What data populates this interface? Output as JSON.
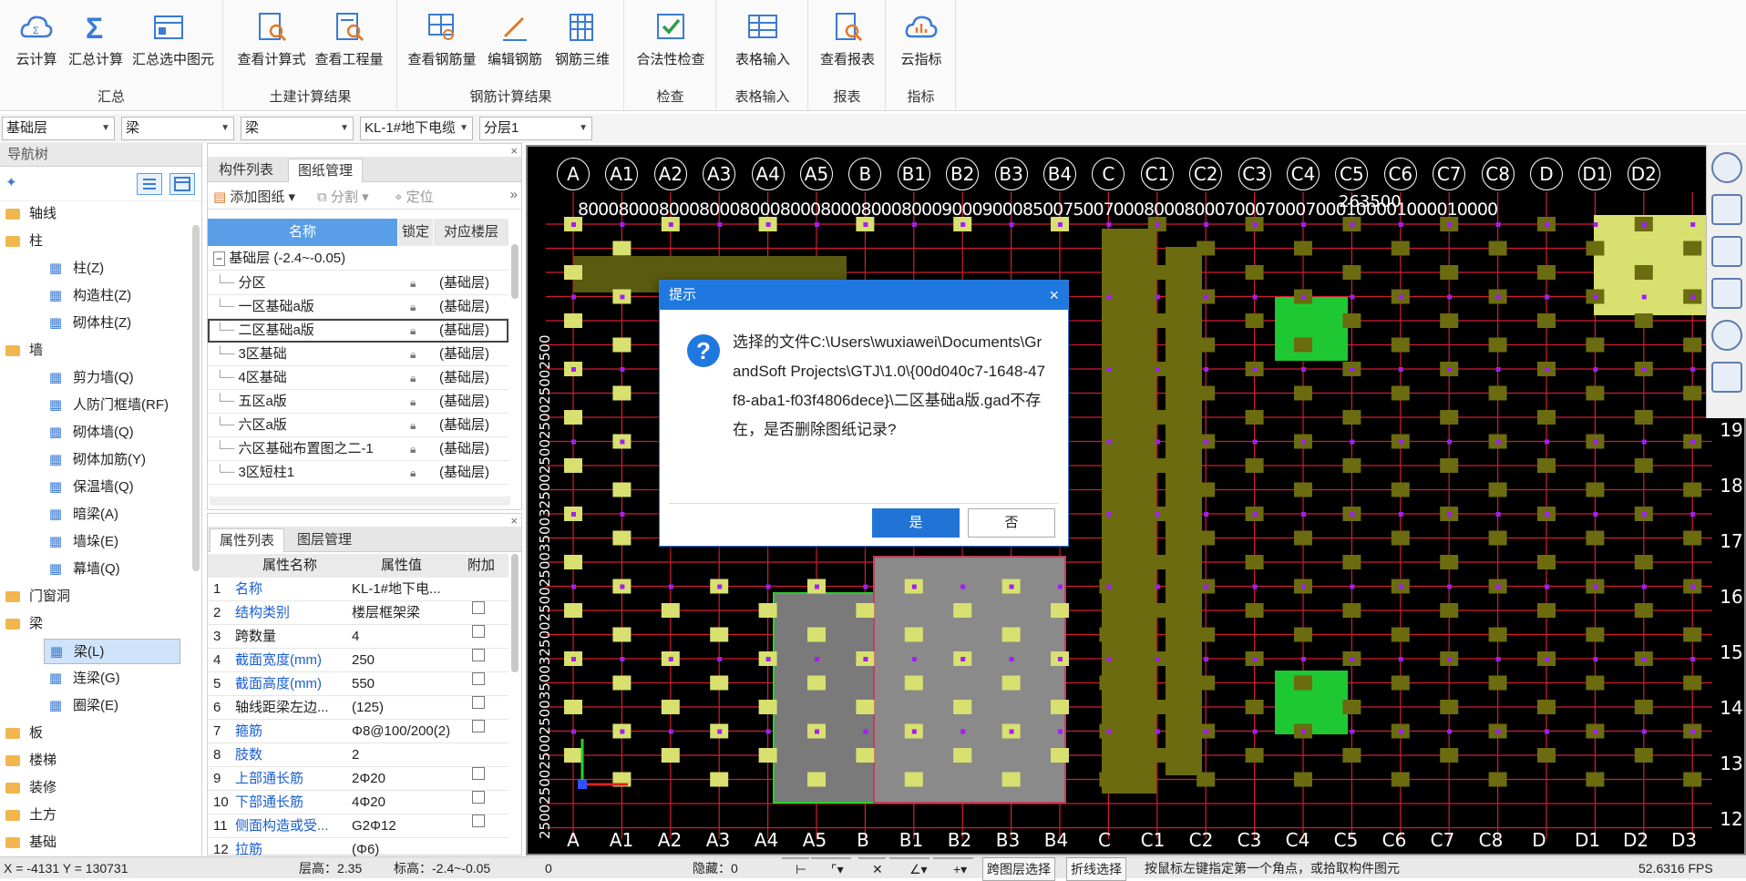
{
  "ribbon": {
    "groups": [
      {
        "name": "汇总",
        "buttons": [
          "云计算",
          "汇总计算",
          "汇总选中图元"
        ]
      },
      {
        "name": "土建计算结果",
        "buttons": [
          "查看计算式",
          "查看工程量"
        ]
      },
      {
        "name": "钢筋计算结果",
        "buttons": [
          "查看钢筋量",
          "编辑钢筋",
          "钢筋三维"
        ]
      },
      {
        "name": "检查",
        "buttons": [
          "合法性检查"
        ]
      },
      {
        "name": "表格输入",
        "buttons": [
          "表格输入"
        ]
      },
      {
        "name": "报表",
        "buttons": [
          "查看报表"
        ]
      },
      {
        "name": "指标",
        "buttons": [
          "云指标"
        ]
      }
    ]
  },
  "selectors": [
    "基础层",
    "梁",
    "梁",
    "KL-1#地下电缆",
    "分层1"
  ],
  "nav": {
    "title": "导航树",
    "items": [
      {
        "label": "轴线",
        "type": "folder"
      },
      {
        "label": "柱",
        "type": "folder"
      },
      {
        "label": "柱(Z)",
        "type": "child",
        "icon": "column-icon"
      },
      {
        "label": "构造柱(Z)",
        "type": "child",
        "icon": "struct-column-icon"
      },
      {
        "label": "砌体柱(Z)",
        "type": "child",
        "icon": "masonry-column-icon"
      },
      {
        "label": "墙",
        "type": "folder"
      },
      {
        "label": "剪力墙(Q)",
        "type": "child",
        "icon": "shear-wall-icon"
      },
      {
        "label": "人防门框墙(RF)",
        "type": "child",
        "icon": "door-frame-wall-icon"
      },
      {
        "label": "砌体墙(Q)",
        "type": "child",
        "icon": "masonry-wall-icon"
      },
      {
        "label": "砌体加筋(Y)",
        "type": "child",
        "icon": "masonry-rebar-icon"
      },
      {
        "label": "保温墙(Q)",
        "type": "child",
        "icon": "insulation-wall-icon"
      },
      {
        "label": "暗梁(A)",
        "type": "child",
        "icon": "hidden-beam-icon"
      },
      {
        "label": "墙垛(E)",
        "type": "child",
        "icon": "pilaster-icon"
      },
      {
        "label": "幕墙(Q)",
        "type": "child",
        "icon": "curtain-wall-icon"
      },
      {
        "label": "门窗洞",
        "type": "folder"
      },
      {
        "label": "梁",
        "type": "folder"
      },
      {
        "label": "梁(L)",
        "type": "child",
        "icon": "beam-icon",
        "selected": true
      },
      {
        "label": "连梁(G)",
        "type": "child",
        "icon": "link-beam-icon"
      },
      {
        "label": "圈梁(E)",
        "type": "child",
        "icon": "ring-beam-icon"
      },
      {
        "label": "板",
        "type": "folder"
      },
      {
        "label": "楼梯",
        "type": "folder"
      },
      {
        "label": "装修",
        "type": "folder"
      },
      {
        "label": "土方",
        "type": "folder"
      },
      {
        "label": "基础",
        "type": "folder"
      }
    ]
  },
  "drawings": {
    "tabs": [
      "构件列表",
      "图纸管理"
    ],
    "toolbar": {
      "add": "添加图纸",
      "split": "分割",
      "locate": "定位"
    },
    "headers": [
      "名称",
      "锁定",
      "对应楼层"
    ],
    "group": "基础层 (-2.4~-0.05)",
    "rows": [
      {
        "name": "分区",
        "floor": "(基础层)"
      },
      {
        "name": "一区基础a版",
        "floor": "(基础层)"
      },
      {
        "name": "二区基础a版",
        "floor": "(基础层)"
      },
      {
        "name": "3区基础",
        "floor": "(基础层)"
      },
      {
        "name": "4区基础",
        "floor": "(基础层)"
      },
      {
        "name": "五区a版",
        "floor": "(基础层)"
      },
      {
        "name": "六区a版",
        "floor": "(基础层)"
      },
      {
        "name": "六区基础布置图之二-1",
        "floor": "(基础层)"
      },
      {
        "name": "3区短柱1",
        "floor": "(基础层)"
      }
    ]
  },
  "props": {
    "tabs": [
      "属性列表",
      "图层管理"
    ],
    "headers": [
      "属性名称",
      "属性值",
      "附加"
    ],
    "rows": [
      {
        "n": "1",
        "name": "名称",
        "value": "KL-1#地下电...",
        "blue": true,
        "cb": false
      },
      {
        "n": "2",
        "name": "结构类别",
        "value": "楼层框架梁",
        "blue": true,
        "cb": true
      },
      {
        "n": "3",
        "name": "跨数量",
        "value": "4",
        "blue": false,
        "cb": true
      },
      {
        "n": "4",
        "name": "截面宽度(mm)",
        "value": "250",
        "blue": true,
        "cb": true
      },
      {
        "n": "5",
        "name": "截面高度(mm)",
        "value": "550",
        "blue": true,
        "cb": true
      },
      {
        "n": "6",
        "name": "轴线距梁左边...",
        "value": "(125)",
        "blue": false,
        "cb": true
      },
      {
        "n": "7",
        "name": "箍筋",
        "value": "Φ8@100/200(2)",
        "blue": true,
        "cb": true
      },
      {
        "n": "8",
        "name": "肢数",
        "value": "2",
        "blue": true,
        "cb": false
      },
      {
        "n": "9",
        "name": "上部通长筋",
        "value": "2Φ20",
        "blue": true,
        "cb": true
      },
      {
        "n": "10",
        "name": "下部通长筋",
        "value": "4Φ20",
        "blue": true,
        "cb": true
      },
      {
        "n": "11",
        "name": "侧面构造或受...",
        "value": "G2Φ12",
        "blue": true,
        "cb": true
      },
      {
        "n": "12",
        "name": "拉筋",
        "value": "(Φ6)",
        "blue": true,
        "cb": false
      }
    ]
  },
  "canvas": {
    "axes_top": [
      "A",
      "A1",
      "A2",
      "A3",
      "A4",
      "A5",
      "B",
      "B1",
      "B2",
      "B3",
      "B4",
      "C",
      "C1",
      "C2",
      "C3",
      "C4",
      "C5",
      "C6",
      "C7",
      "C8",
      "D",
      "D1",
      "D2"
    ],
    "axes_bottom": [
      "A",
      "A1",
      "A2",
      "A3",
      "A4",
      "A5",
      "B",
      "B1",
      "B2",
      "B3",
      "B4",
      "C",
      "C1",
      "C2",
      "C3",
      "C4",
      "C5",
      "C6",
      "C7",
      "C8",
      "D",
      "D1",
      "D2",
      "D3"
    ],
    "dim_top": "8000800080008000800080008000800080009000900085007500700080008000700070007000100001000010000",
    "dim_total": "263500",
    "right_axes": [
      "19",
      "18",
      "17",
      "16",
      "15",
      "14",
      "13",
      "12"
    ],
    "left_dims": "2500250025002500350032500250025003500325002500250025002500"
  },
  "dialog": {
    "title": "提示",
    "message": "选择的文件C:\\Users\\wuxiawei\\Documents\\GrandSoft Projects\\GTJ\\1.0\\{00d040c7-1648-47f8-aba1-f03f4806dece}\\二区基础a版.gad不存在，是否删除图纸记录?",
    "yes": "是",
    "no": "否"
  },
  "status": {
    "coords": "X = -4131 Y = 130731",
    "floor_height": "层高：2.35",
    "elevation": "标高：-2.4~-0.05",
    "zero": "0",
    "hidden": "隐藏：0",
    "cross_floor": "跨图层选择",
    "polyline": "折线选择",
    "hint": "按鼠标左键指定第一个角点，或拾取构件图元",
    "fps": "52.6316 FPS"
  }
}
